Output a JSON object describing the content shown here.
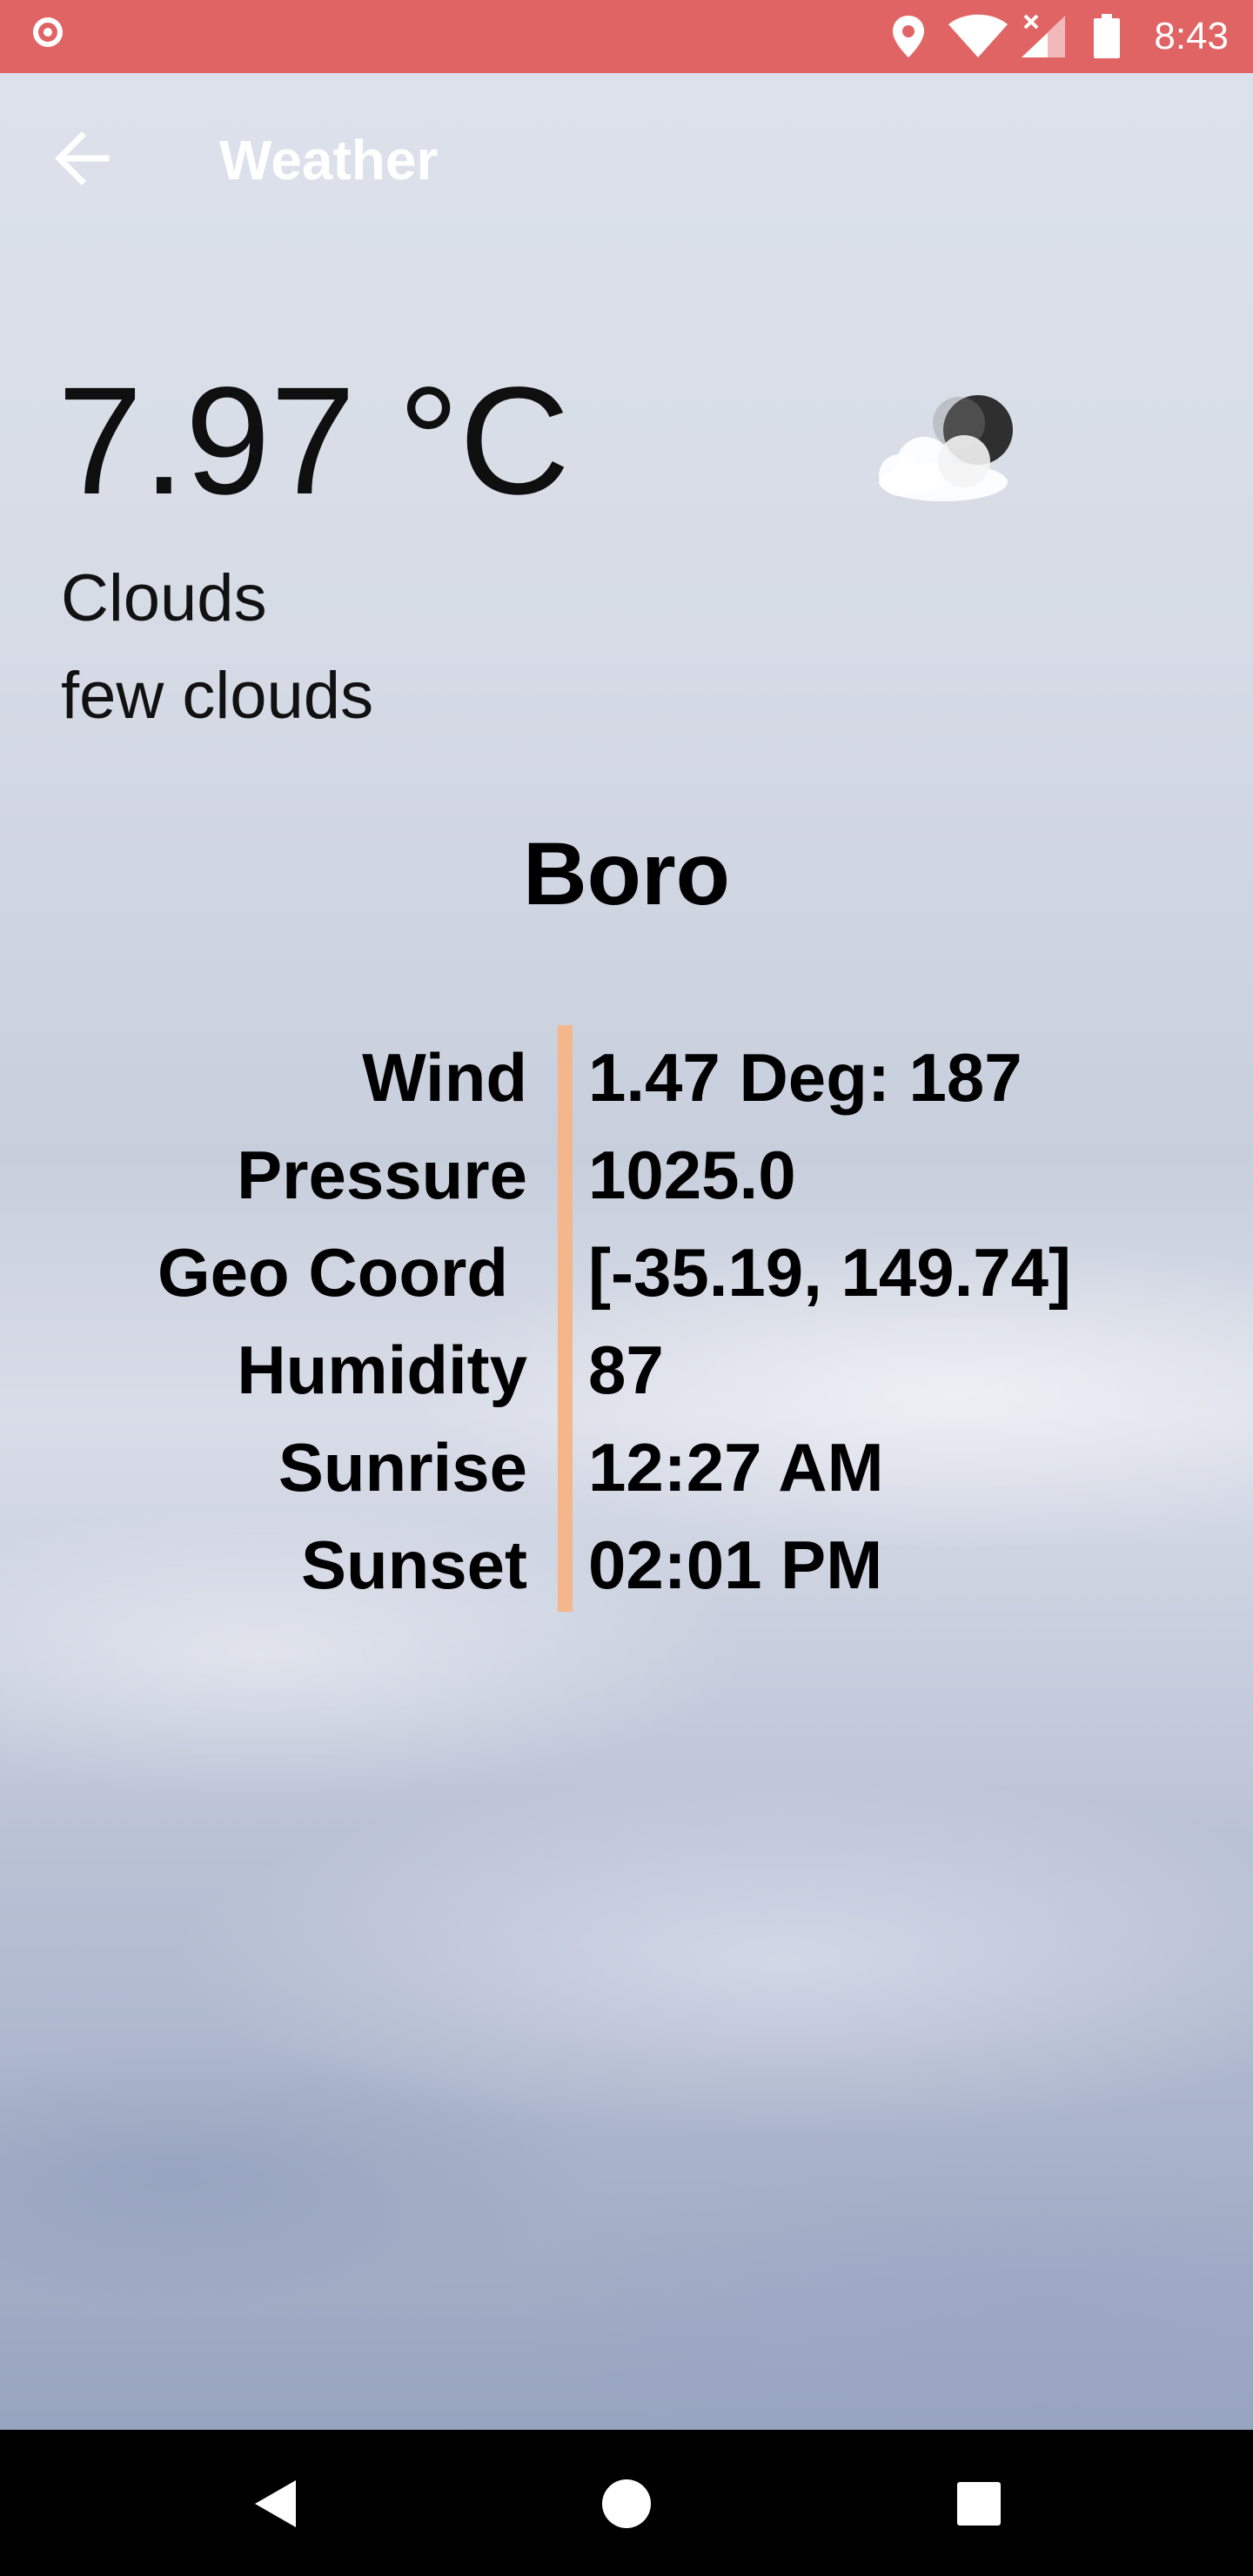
{
  "status_bar": {
    "time": "8:43",
    "icons": [
      "record-icon",
      "location-icon",
      "wifi-icon",
      "signal-icon",
      "battery-icon"
    ],
    "background_color": "#e06464"
  },
  "app_bar": {
    "title": "Weather",
    "back_icon": "arrow-left-icon"
  },
  "current": {
    "temperature": "7.97 °C",
    "condition": "Clouds",
    "description": "few clouds",
    "icon": "cloud-night-icon"
  },
  "city": "Boro",
  "details": [
    {
      "label": "Wind",
      "value": "1.47 Deg: 187"
    },
    {
      "label": "Pressure",
      "value": "1025.0"
    },
    {
      "label": "Geo Coord",
      "value": "[-35.19, 149.74]"
    },
    {
      "label": "Humidity",
      "value": "87"
    },
    {
      "label": "Sunrise",
      "value": "12:27 AM"
    },
    {
      "label": "Sunset",
      "value": "02:01 PM"
    }
  ],
  "divider_color": "#f4b68a",
  "nav_bar": {
    "buttons": [
      "back-triangle-icon",
      "home-circle-icon",
      "recents-square-icon"
    ]
  }
}
